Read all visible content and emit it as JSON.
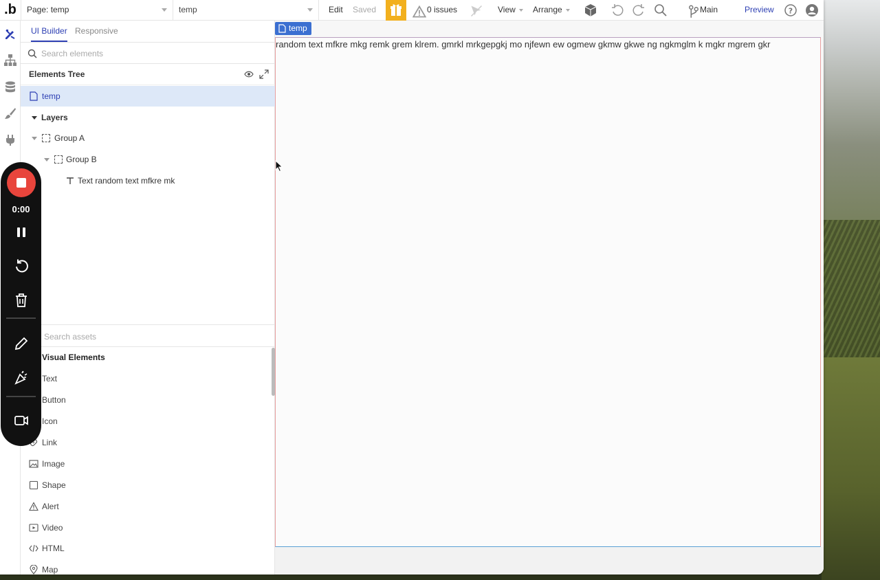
{
  "topbar": {
    "logo": ".b",
    "page_select": "Page: temp",
    "view_select": "temp",
    "edit": "Edit",
    "saved": "Saved",
    "issues": "0 issues",
    "view": "View",
    "arrange": "Arrange",
    "branch": "Main",
    "preview": "Preview"
  },
  "panel": {
    "tabs": [
      "UI Builder",
      "Responsive"
    ],
    "search_placeholder": "Search elements",
    "tree_title": "Elements Tree",
    "tree": {
      "page": "temp",
      "layers": "Layers",
      "group_a": "Group A",
      "group_b": "Group B",
      "text_el": "Text random text mfkre mk"
    },
    "assets_search_placeholder": "Search assets",
    "category": "Visual Elements",
    "assets": [
      "Text",
      "Button",
      "Icon",
      "Link",
      "Image",
      "Shape",
      "Alert",
      "Video",
      "HTML",
      "Map"
    ]
  },
  "canvas": {
    "page_badge": "temp",
    "text": "random text mfkre mkg remk grem klrem. gmrkl mrkgepgkj mo njfewn ew ogmew gkmw gkwe ng ngkmglm k mgkr mgrem gkr"
  },
  "recorder": {
    "time": "0:00"
  },
  "colors": {
    "accent": "#2d3fb3",
    "badge": "#3b6fd1",
    "gift": "#f2b01e",
    "record": "#e8453c",
    "selection": "#dde8f8"
  }
}
